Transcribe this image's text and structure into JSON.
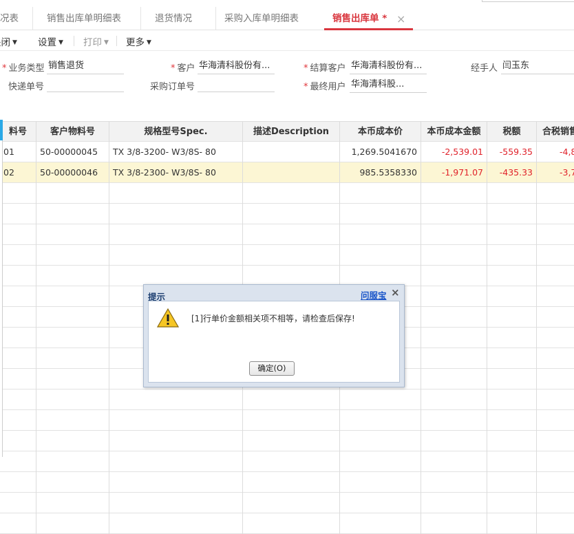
{
  "tabs": [
    {
      "label": "况表"
    },
    {
      "label": "销售出库单明细表"
    },
    {
      "label": "退货情况"
    },
    {
      "label": "采购入库单明细表"
    },
    {
      "label": "销售出库单 *"
    }
  ],
  "tab_close": "×",
  "toolbar": {
    "close": "关闭",
    "settings": "设置",
    "print": "打印",
    "more": "更多"
  },
  "form": {
    "business_type_label": "业务类型",
    "business_type_value": "销售退货",
    "customer_label": "客户",
    "customer_value": "华海清科股份有...",
    "settle_customer_label": "结算客户",
    "settle_customer_value": "华海清科股份有...",
    "handler_label": "经手人",
    "handler_value": "闫玉东",
    "express_no_label": "快递单号",
    "express_no_value": "",
    "po_no_label": "采购订单号",
    "po_no_value": "",
    "end_user_label": "最终用户",
    "end_user_value": "华海清科股..."
  },
  "table": {
    "headers": [
      "料号",
      "客户物料号",
      "规格型号Spec.",
      "描述Description",
      "本币成本价",
      "本币成本金额",
      "税额",
      "合税销售"
    ],
    "rows": [
      {
        "item": "01",
        "cust_item": "50-00000045",
        "spec": "TX  3/8-3200-  W3/8S-  80",
        "desc": "",
        "unit_cost": "1,269.5041670",
        "cost_amount": "-2,539.01",
        "tax": "-559.35",
        "total": "-4,8"
      },
      {
        "item": "02",
        "cust_item": "50-00000046",
        "spec": "TX  3/8-2300-  W3/8S-  80",
        "desc": "",
        "unit_cost": "985.5358330",
        "cost_amount": "-1,971.07",
        "tax": "-435.33",
        "total": "-3,7"
      }
    ]
  },
  "dialog": {
    "title": "提示",
    "help_link": "问服宝",
    "close": "×",
    "message": "[1]行单价金额相关项不相等，请检查后保存!",
    "ok_button": "确定(O)"
  },
  "colors": {
    "active_tab": "#d9363e",
    "negative": "#e0222a",
    "selected_row": "#fcf6d4",
    "link": "#1a55c9"
  }
}
